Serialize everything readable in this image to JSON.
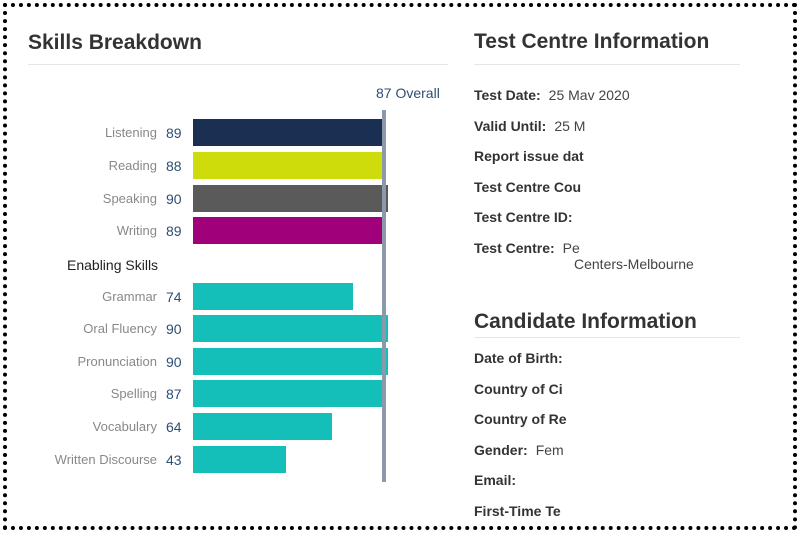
{
  "chart_data": {
    "type": "bar",
    "title": "Skills Breakdown",
    "overall_label": "87 Overall",
    "overall": 87,
    "xlim": [
      0,
      90
    ],
    "communicative": [
      {
        "label": "Listening",
        "value": 89,
        "color": "#1b2f52"
      },
      {
        "label": "Reading",
        "value": 88,
        "color": "#cfdc0c"
      },
      {
        "label": "Speaking",
        "value": 90,
        "color": "#5a5a5a"
      },
      {
        "label": "Writing",
        "value": 89,
        "color": "#a0007a"
      }
    ],
    "enabling_title": "Enabling Skills",
    "enabling": [
      {
        "label": "Grammar",
        "value": 74,
        "color": "#13bfb8"
      },
      {
        "label": "Oral Fluency",
        "value": 90,
        "color": "#13bfb8"
      },
      {
        "label": "Pronunciation",
        "value": 90,
        "color": "#13bfb8"
      },
      {
        "label": "Spelling",
        "value": 87,
        "color": "#13bfb8"
      },
      {
        "label": "Vocabulary",
        "value": 64,
        "color": "#13bfb8"
      },
      {
        "label": "Written Discourse",
        "value": 43,
        "color": "#13bfb8"
      }
    ]
  },
  "test_centre": {
    "title": "Test Centre Information",
    "rows": [
      {
        "k": "Test Date:",
        "v": "25 Mav 2020"
      },
      {
        "k": "Valid Until:",
        "v": "25 M"
      },
      {
        "k": "Report issue dat",
        "v": ""
      },
      {
        "k": "Test Centre Cou",
        "v": ""
      },
      {
        "k": "Test Centre ID:",
        "v": ""
      },
      {
        "k": "Test Centre:",
        "v": "Pe"
      }
    ],
    "centre_cont": "Centers-Melbourne"
  },
  "candidate": {
    "title": "Candidate Information",
    "rows": [
      {
        "k": "Date of Birth:",
        "v": ""
      },
      {
        "k": "Country of Ci",
        "v": ""
      },
      {
        "k": "Country of Re",
        "v": ""
      },
      {
        "k": "Gender:",
        "v": "Fem"
      },
      {
        "k": "Email:",
        "v": ""
      },
      {
        "k": "First-Time Te",
        "v": ""
      }
    ]
  }
}
